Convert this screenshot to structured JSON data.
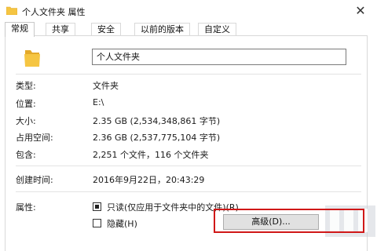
{
  "window": {
    "title": "个人文件夹 属性",
    "close_glyph": "✕",
    "folder_color": "#f5c542",
    "folder_color_dark": "#e3a92a"
  },
  "tabs": [
    {
      "label": "常规",
      "active": true
    },
    {
      "label": "共享",
      "active": false
    },
    {
      "label": "安全",
      "active": false
    },
    {
      "label": "以前的版本",
      "active": false
    },
    {
      "label": "自定义",
      "active": false
    }
  ],
  "general": {
    "name_value": "个人文件夹",
    "type_label": "类型:",
    "type_value": "文件夹",
    "location_label": "位置:",
    "location_value": "E:\\",
    "size_label": "大小:",
    "size_value": "2.35 GB (2,534,348,861 字节)",
    "size_on_disk_label": "占用空间:",
    "size_on_disk_value": "2.36 GB (2,537,775,104 字节)",
    "contains_label": "包含:",
    "contains_value": "2,251 个文件，116 个文件夹",
    "created_label": "创建时间:",
    "created_value": "2016年9月22日，20:43:29",
    "attributes_label": "属性:",
    "readonly_label": "只读(仅应用于文件夹中的文件)(R)",
    "readonly_checked": true,
    "hidden_label": "隐藏(H)",
    "hidden_checked": false,
    "advanced_button": "高级(D)...",
    "highlight_color": "#d01818"
  }
}
